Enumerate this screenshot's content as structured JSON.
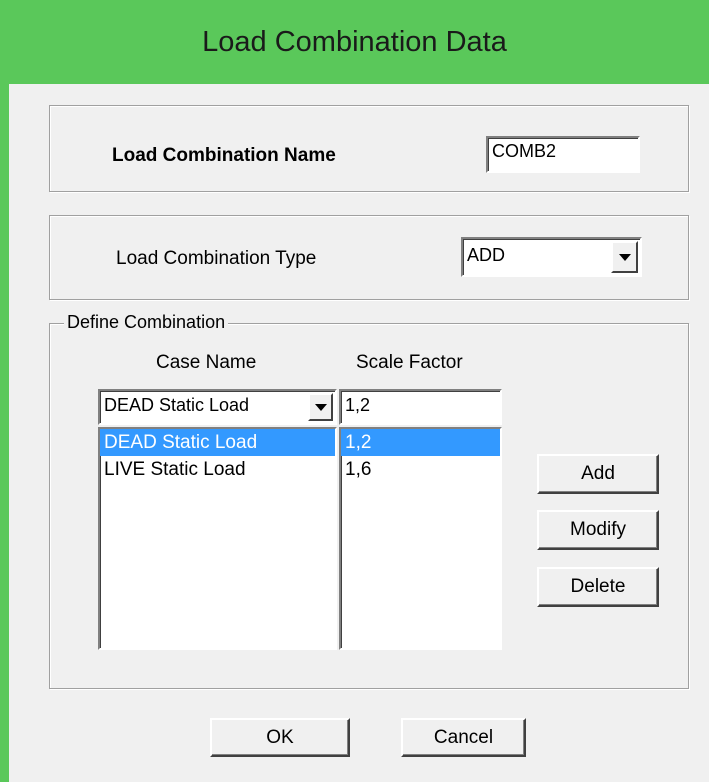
{
  "window": {
    "title": "Load Combination Data"
  },
  "name_group": {
    "label": "Load Combination Name",
    "value": "COMB2"
  },
  "type_group": {
    "label": "Load Combination Type",
    "selected": "ADD"
  },
  "define_group": {
    "legend": "Define Combination",
    "case_header": "Case Name",
    "scale_header": "Scale Factor",
    "case_selected": "DEAD Static Load",
    "scale_input": "1,2",
    "rows": [
      {
        "case": "DEAD Static Load",
        "scale": "1,2",
        "selected": true
      },
      {
        "case": "LIVE Static Load",
        "scale": "1,6",
        "selected": false
      }
    ],
    "add_label": "Add",
    "modify_label": "Modify",
    "delete_label": "Delete"
  },
  "footer": {
    "ok_label": "OK",
    "cancel_label": "Cancel"
  },
  "colors": {
    "titlebar": "#5ac85a",
    "selection": "#3399ff",
    "dialog_bg": "#f0f0f0"
  }
}
